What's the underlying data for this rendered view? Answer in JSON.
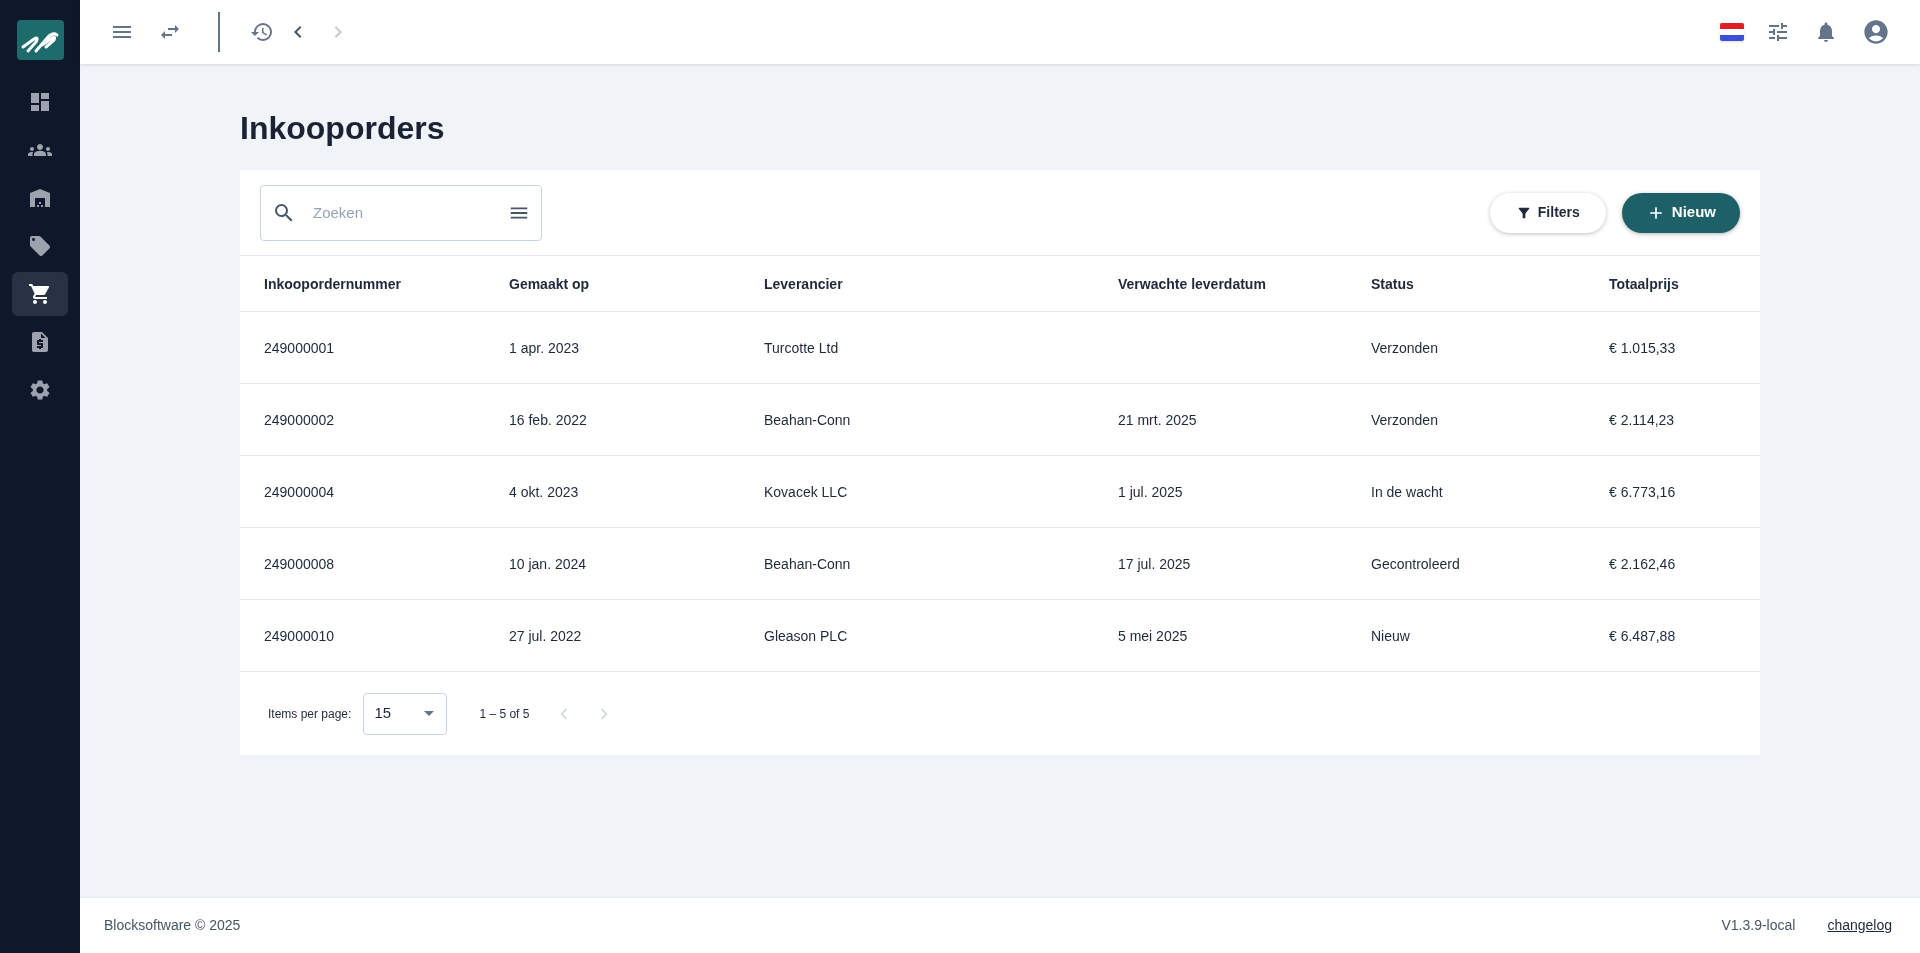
{
  "sidebar": {
    "items": [
      {
        "kind": "dashboard",
        "selected": false
      },
      {
        "kind": "people",
        "selected": false
      },
      {
        "kind": "warehouse",
        "selected": false
      },
      {
        "kind": "tag",
        "selected": false
      },
      {
        "kind": "cart",
        "selected": true
      },
      {
        "kind": "invoice",
        "selected": false
      },
      {
        "kind": "settings",
        "selected": false
      }
    ]
  },
  "topbar": {
    "nav": [
      {
        "kind": "back",
        "disabled": false
      },
      {
        "kind": "forward",
        "disabled": true
      }
    ]
  },
  "page": {
    "title": "Inkooporders"
  },
  "search": {
    "placeholder": "Zoeken"
  },
  "actions": {
    "filters": "Filters",
    "new": "Nieuw"
  },
  "table": {
    "columns": [
      "Inkoopordernummer",
      "Gemaakt op",
      "Leverancier",
      "Verwachte leverdatum",
      "Status",
      "Totaalprijs"
    ],
    "rows": [
      [
        "249000001",
        "1 apr. 2023",
        "Turcotte Ltd",
        "",
        "Verzonden",
        "€ 1.015,33"
      ],
      [
        "249000002",
        "16 feb. 2022",
        "Beahan-Conn",
        "21 mrt. 2025",
        "Verzonden",
        "€ 2.114,23"
      ],
      [
        "249000004",
        "4 okt. 2023",
        "Kovacek LLC",
        "1 jul. 2025",
        "In de wacht",
        "€ 6.773,16"
      ],
      [
        "249000008",
        "10 jan. 2024",
        "Beahan-Conn",
        "17 jul. 2025",
        "Gecontroleerd",
        "€ 2.162,46"
      ],
      [
        "249000010",
        "27 jul. 2022",
        "Gleason PLC",
        "5 mei 2025",
        "Nieuw",
        "€ 6.487,88"
      ]
    ]
  },
  "pagination": {
    "label": "Items per page:",
    "page_size": "15",
    "range": "1 – 5 of 5",
    "prev_disabled": true,
    "next_disabled": true
  },
  "footer": {
    "copyright": "Blocksoftware © 2025",
    "version": "V1.3.9-local",
    "link": "changelog"
  }
}
